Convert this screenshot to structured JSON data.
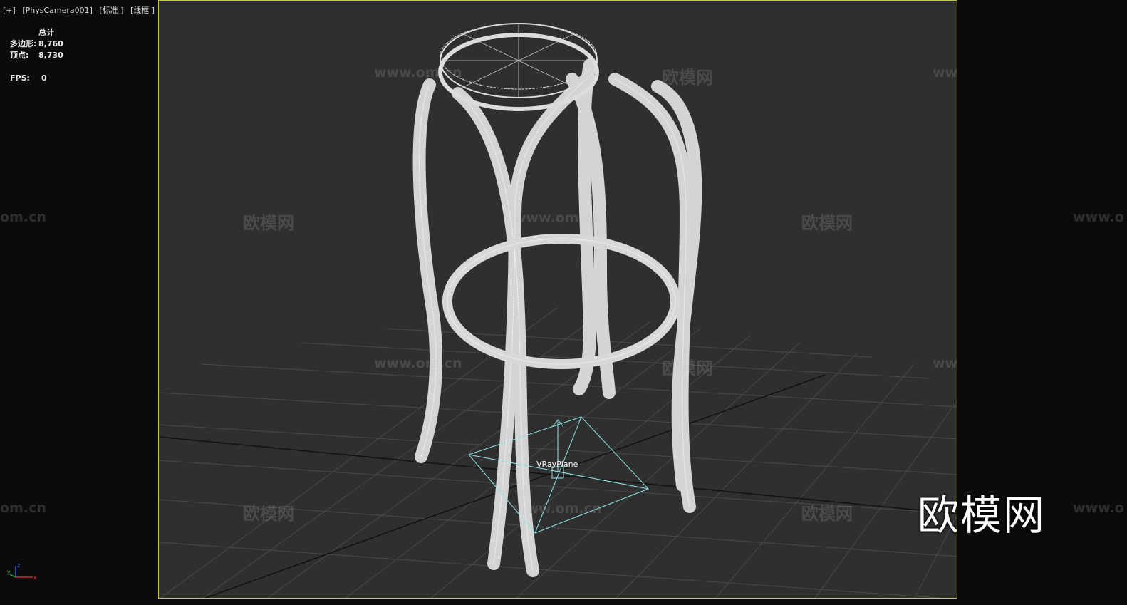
{
  "viewport": {
    "label_parts": [
      "[+]",
      "[PhysCamera001]",
      "[标准 ]",
      "[线框 ]"
    ],
    "frame_color": "#c8c84a",
    "background": "#2f2f2f"
  },
  "stats": {
    "title": "总计",
    "polygons_label": "多边形:",
    "polygons_value": "8,760",
    "vertices_label": "顶点:",
    "vertices_value": "8,730",
    "fps_label": "FPS:",
    "fps_value": "0"
  },
  "scene": {
    "object_wire_color": "#dcdcdc",
    "light_color": "#8fe6e6",
    "light_label": "VRayPlane"
  },
  "watermarks": {
    "cn": "欧模网",
    "url": "www.om.cn",
    "url_partial_left": "om.cn",
    "url_partial_right": "www.o"
  },
  "brand": "欧模网",
  "gizmo": {
    "x": "x",
    "y": "y",
    "z": "z"
  }
}
